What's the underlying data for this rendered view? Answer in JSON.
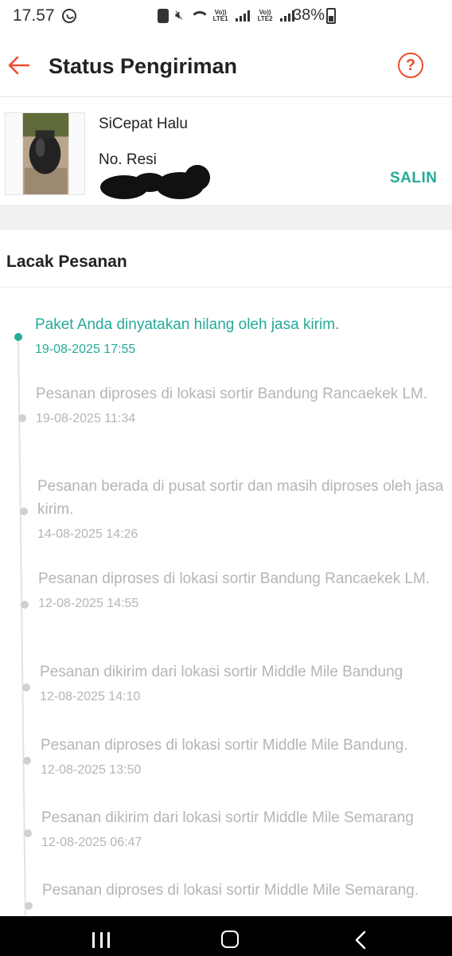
{
  "status_bar": {
    "time": "17.57",
    "battery": "38%",
    "icons": [
      "whatsapp-icon",
      "lock-icon",
      "mute-icon",
      "wifi-icon",
      "volte-lte1-icon",
      "signal-1-icon",
      "volte-lte2-icon",
      "signal-2-icon",
      "battery-icon"
    ],
    "volte1": "Vo)) LTE1",
    "volte2": "Vo)) LTE2"
  },
  "header": {
    "title": "Status Pengiriman",
    "back_icon": "arrow-left-icon",
    "help_label": "?",
    "accent": "#ee4d2d"
  },
  "shipment": {
    "courier": "SiCepat Halu",
    "resi_label": "No. Resi",
    "copy_label": "SALIN",
    "accent": "#26aa99"
  },
  "tracking": {
    "title": "Lacak Pesanan",
    "events": [
      {
        "desc": "Paket Anda dinyatakan hilang oleh jasa kirim.",
        "time": "19-08-2025 17:55",
        "active": true
      },
      {
        "desc": "Pesanan diproses di lokasi sortir  Bandung Rancaekek LM.",
        "time": "19-08-2025 11:34",
        "active": false
      },
      {
        "desc": "Pesanan berada di pusat sortir dan masih diproses oleh jasa kirim.",
        "time": "14-08-2025 14:26",
        "active": false
      },
      {
        "desc": "Pesanan diproses di lokasi sortir  Bandung Rancaekek LM.",
        "time": "12-08-2025 14:55",
        "active": false
      },
      {
        "desc": "Pesanan dikirim dari lokasi sortir  Middle Mile Bandung",
        "time": "12-08-2025 14:10",
        "active": false
      },
      {
        "desc": "Pesanan diproses di lokasi sortir  Middle Mile Bandung.",
        "time": "12-08-2025 13:50",
        "active": false
      },
      {
        "desc": "Pesanan dikirim dari lokasi sortir  Middle Mile Semarang",
        "time": "12-08-2025 06:47",
        "active": false
      },
      {
        "desc": "Pesanan diproses di lokasi sortir  Middle Mile Semarang.",
        "time": "",
        "active": false
      }
    ]
  },
  "nav_bar": {
    "icons": [
      "recents-icon",
      "home-icon",
      "back-icon"
    ]
  }
}
